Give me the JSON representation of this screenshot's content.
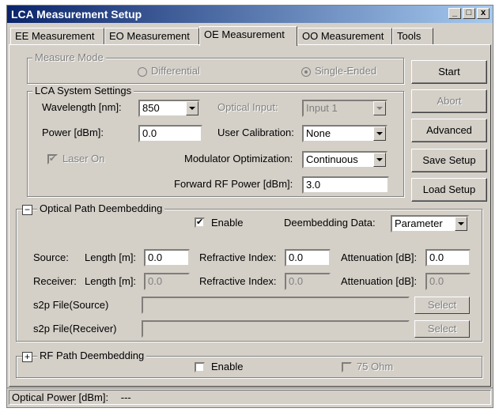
{
  "window": {
    "title": "LCA Measurement Setup",
    "min_label": "_",
    "max_label": "□",
    "close_label": "x"
  },
  "tabs": [
    {
      "label": "EE Measurement"
    },
    {
      "label": "EO Measurement"
    },
    {
      "label": "OE Measurement",
      "active": true
    },
    {
      "label": "OO Measurement"
    },
    {
      "label": "Tools"
    }
  ],
  "measure_mode": {
    "legend": "Measure Mode",
    "differential": "Differential",
    "single_ended": "Single-Ended",
    "selected": "Single-Ended"
  },
  "lca": {
    "legend": "LCA System Settings",
    "wavelength_label": "Wavelength [nm]:",
    "wavelength_value": "850",
    "optical_input_label": "Optical Input:",
    "optical_input_value": "Input 1",
    "power_label": "Power [dBm]:",
    "power_value": "0.0",
    "user_cal_label": "User Calibration:",
    "user_cal_value": "None",
    "laser_on_label": "Laser On",
    "laser_on_checked": true,
    "mod_opt_label": "Modulator Optimization:",
    "mod_opt_value": "Continuous",
    "fwd_rf_label": "Forward RF Power [dBm]:",
    "fwd_rf_value": "3.0"
  },
  "buttons": {
    "start": "Start",
    "abort": "Abort",
    "advanced": "Advanced",
    "save_setup": "Save Setup",
    "load_setup": "Load Setup"
  },
  "optical": {
    "expander": "−",
    "legend": "Optical Path Deembedding",
    "enable_label": "Enable",
    "enable_checked": true,
    "deembed_label": "Deembedding Data:",
    "deembed_value": "Parameter",
    "source_label": "Source:",
    "source_length_label": "Length [m]:",
    "source_length": "0.0",
    "source_ri_label": "Refractive Index:",
    "source_ri": "0.0",
    "source_att_label": "Attenuation [dB]:",
    "source_att": "0.0",
    "receiver_label": "Receiver:",
    "receiver_length_label": "Length [m]:",
    "receiver_length": "0.0",
    "receiver_ri_label": "Refractive Index:",
    "receiver_ri": "0.0",
    "receiver_att_label": "Attenuation [dB]:",
    "receiver_att": "0.0",
    "s2p_source_label": "s2p File(Source)",
    "s2p_source_value": "",
    "s2p_receiver_label": "s2p File(Receiver)",
    "s2p_receiver_value": "",
    "select_label": "Select"
  },
  "rf": {
    "expander": "+",
    "legend": "RF Path Deembedding",
    "enable_label": "Enable",
    "ohm_label": "75 Ohm"
  },
  "status": {
    "label": "Optical Power [dBm]:",
    "value": "---"
  }
}
